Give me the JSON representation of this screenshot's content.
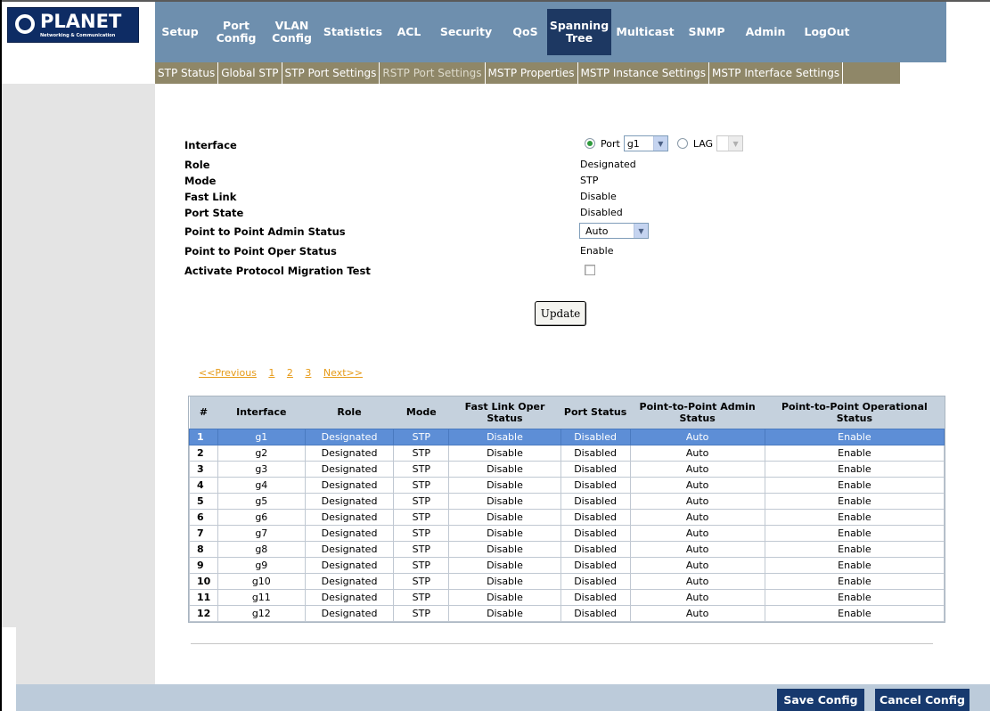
{
  "brand": {
    "name": "PLANET",
    "tagline": "Networking & Communication"
  },
  "nav": {
    "items": [
      {
        "label": "Setup",
        "active": false
      },
      {
        "label": "Port Config",
        "active": false
      },
      {
        "label": "VLAN Config",
        "active": false
      },
      {
        "label": "Statistics",
        "active": false
      },
      {
        "label": "ACL",
        "active": false
      },
      {
        "label": "Security",
        "active": false
      },
      {
        "label": "QoS",
        "active": false
      },
      {
        "label": "Spanning Tree",
        "active": true
      },
      {
        "label": "Multicast",
        "active": false
      },
      {
        "label": "SNMP",
        "active": false
      },
      {
        "label": "Admin",
        "active": false
      },
      {
        "label": "LogOut",
        "active": false
      }
    ]
  },
  "subnav": {
    "items": [
      {
        "label": "STP Status",
        "active": false
      },
      {
        "label": "Global STP",
        "active": false
      },
      {
        "label": "STP Port Settings",
        "active": false
      },
      {
        "label": "RSTP Port Settings",
        "active": true
      },
      {
        "label": "MSTP Properties",
        "active": false
      },
      {
        "label": "MSTP Instance Settings",
        "active": false
      },
      {
        "label": "MSTP Interface Settings",
        "active": false
      }
    ]
  },
  "form": {
    "interface_label": "Interface",
    "port_radio_label": "Port",
    "port_value": "g1",
    "lag_radio_label": "LAG",
    "lag_value": "",
    "role_label": "Role",
    "role_value": "Designated",
    "mode_label": "Mode",
    "mode_value": "STP",
    "fast_link_label": "Fast Link",
    "fast_link_value": "Disable",
    "port_state_label": "Port State",
    "port_state_value": "Disabled",
    "p2p_admin_label": "Point to Point Admin Status",
    "p2p_admin_value": "Auto",
    "p2p_oper_label": "Point to Point Oper Status",
    "p2p_oper_value": "Enable",
    "migration_label": "Activate Protocol Migration Test",
    "update_label": "Update"
  },
  "pager": {
    "prev": "<<Previous",
    "pages": [
      "1",
      "2",
      "3"
    ],
    "next": "Next>>"
  },
  "table": {
    "headers": [
      "#",
      "Interface",
      "Role",
      "Mode",
      "Fast Link Oper Status",
      "Port Status",
      "Point-to-Point Admin Status",
      "Point-to-Point Operational Status"
    ],
    "rows": [
      [
        "1",
        "g1",
        "Designated",
        "STP",
        "Disable",
        "Disabled",
        "Auto",
        "Enable"
      ],
      [
        "2",
        "g2",
        "Designated",
        "STP",
        "Disable",
        "Disabled",
        "Auto",
        "Enable"
      ],
      [
        "3",
        "g3",
        "Designated",
        "STP",
        "Disable",
        "Disabled",
        "Auto",
        "Enable"
      ],
      [
        "4",
        "g4",
        "Designated",
        "STP",
        "Disable",
        "Disabled",
        "Auto",
        "Enable"
      ],
      [
        "5",
        "g5",
        "Designated",
        "STP",
        "Disable",
        "Disabled",
        "Auto",
        "Enable"
      ],
      [
        "6",
        "g6",
        "Designated",
        "STP",
        "Disable",
        "Disabled",
        "Auto",
        "Enable"
      ],
      [
        "7",
        "g7",
        "Designated",
        "STP",
        "Disable",
        "Disabled",
        "Auto",
        "Enable"
      ],
      [
        "8",
        "g8",
        "Designated",
        "STP",
        "Disable",
        "Disabled",
        "Auto",
        "Enable"
      ],
      [
        "9",
        "g9",
        "Designated",
        "STP",
        "Disable",
        "Disabled",
        "Auto",
        "Enable"
      ],
      [
        "10",
        "g10",
        "Designated",
        "STP",
        "Disable",
        "Disabled",
        "Auto",
        "Enable"
      ],
      [
        "11",
        "g11",
        "Designated",
        "STP",
        "Disable",
        "Disabled",
        "Auto",
        "Enable"
      ],
      [
        "12",
        "g12",
        "Designated",
        "STP",
        "Disable",
        "Disabled",
        "Auto",
        "Enable"
      ]
    ]
  },
  "footer": {
    "save_label": "Save Config",
    "cancel_label": "Cancel Config"
  },
  "colors": {
    "nav_bg": "#6e8fae",
    "nav_active": "#1d3862",
    "subnav_bg": "#8f8768",
    "link": "#e69a17",
    "selected_row": "#5d8ed6",
    "footer_button": "#17396e"
  }
}
